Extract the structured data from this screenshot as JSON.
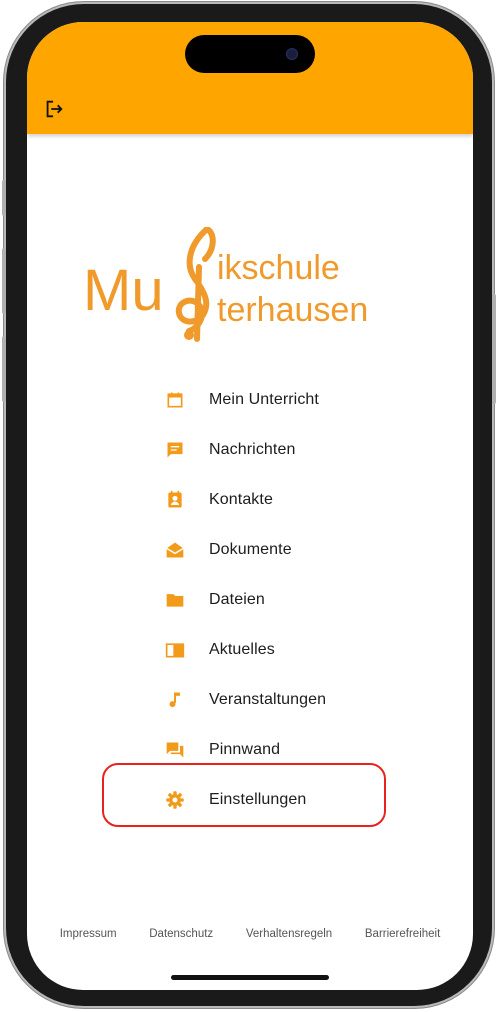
{
  "header": {
    "logout_icon": "logout-icon",
    "accent_color": "#FFA500"
  },
  "logo": {
    "line1_left": "Mu",
    "line1_right": "ikschule",
    "line2_right": "terhausen",
    "symbol": "treble-clef"
  },
  "menu": [
    {
      "label": "Mein Unterricht",
      "icon": "calendar-icon"
    },
    {
      "label": "Nachrichten",
      "icon": "chat-icon"
    },
    {
      "label": "Kontakte",
      "icon": "contact-icon"
    },
    {
      "label": "Dokumente",
      "icon": "mail-open-icon"
    },
    {
      "label": "Dateien",
      "icon": "folder-icon"
    },
    {
      "label": "Aktuelles",
      "icon": "book-icon"
    },
    {
      "label": "Veranstaltungen",
      "icon": "music-note-icon"
    },
    {
      "label": "Pinnwand",
      "icon": "forum-icon"
    },
    {
      "label": "Einstellungen",
      "icon": "gear-icon"
    }
  ],
  "highlight_color": "#e8221e",
  "footer": {
    "impressum": "Impressum",
    "datenschutz": "Datenschutz",
    "verhaltensregeln": "Verhaltensregeln",
    "barrierefreiheit": "Barrierefreiheit"
  }
}
